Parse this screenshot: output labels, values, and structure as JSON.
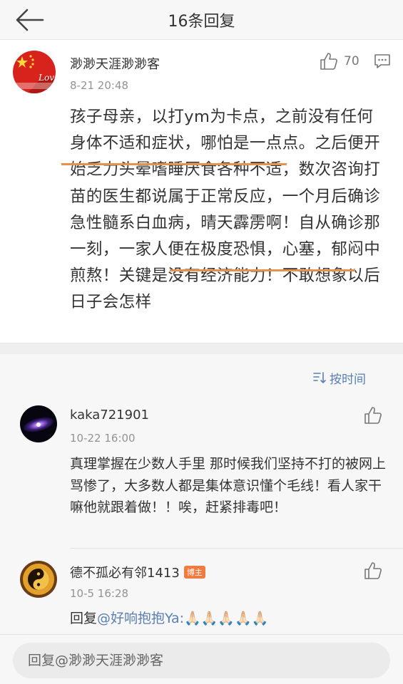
{
  "header": {
    "title": "16条回复"
  },
  "post": {
    "author": "渺渺天涯渺渺客",
    "time": "8-21 20:48",
    "likes": "70",
    "text": "孩子母亲，以打ym为卡点，之前没有任何身体不适和症状，哪怕是一点点。之后便开始乏力头晕嗜睡厌食各种不适，数次咨询打苗的医生都说属于正常反应，一个月后确诊急性髓系白血病，晴天霹雳啊！自从确诊那一刻，一家人便在极度恐惧，心塞，郁闷中煎熬！关键是没有经济能力！不敢想象以后日子会怎样",
    "avatar_badge_text": "Love\n中国加油"
  },
  "sort": {
    "label": "按时间",
    "icon": "sort-icon"
  },
  "replies": [
    {
      "author": "kaka721901",
      "time": "10-22 16:00",
      "text": "真理掌握在少数人手里 那时候我们坚持不打的被网上骂惨了，大多数人都是集体意识懂个毛线！看人家干嘛他就跟着做！！唉，赶紧排毒吧！"
    },
    {
      "author": "德不孤必有邻1413",
      "badge": "博主",
      "time": "10-5 16:28",
      "reply_prefix": "回复",
      "mention": "@好响抱抱Ya:",
      "emoji": "🙏🏻🙏🏻🙏🏻🙏🏻🙏🏻"
    }
  ],
  "footer": {
    "input_placeholder": "回复@渺渺天涯渺渺客"
  },
  "colors": {
    "underline": "#e8914a",
    "link": "#5b7fb3",
    "badge": "#f07b3f"
  }
}
